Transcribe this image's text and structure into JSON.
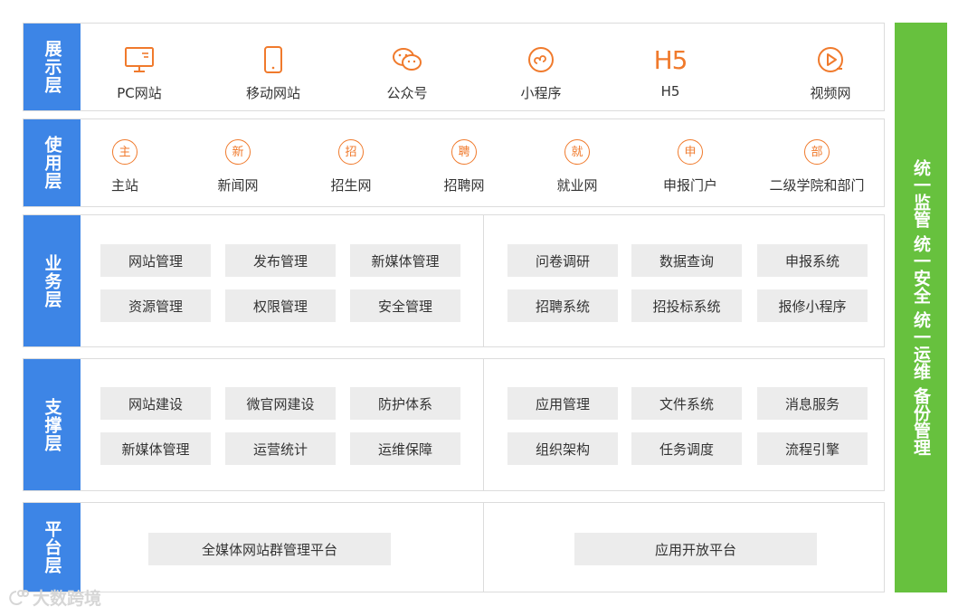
{
  "colors": {
    "label_bg": "#3d85e6",
    "accent": "#f07a2c",
    "right_bar": "#67c13e",
    "box_bg": "#ececec"
  },
  "layers": {
    "display": {
      "label": "展示层",
      "items": [
        {
          "label": "PC网站",
          "icon": "monitor-icon"
        },
        {
          "label": "移动网站",
          "icon": "mobile-phone-icon"
        },
        {
          "label": "公众号",
          "icon": "wechat-icon"
        },
        {
          "label": "小程序",
          "icon": "mini-program-icon"
        },
        {
          "label": "H5",
          "icon": "h5-icon",
          "icon_text": "H5"
        },
        {
          "label": "视频网",
          "icon": "video-play-icon"
        }
      ]
    },
    "usage": {
      "label": "使用层",
      "items": [
        {
          "label": "主站",
          "badge": "主"
        },
        {
          "label": "新闻网",
          "badge": "新"
        },
        {
          "label": "招生网",
          "badge": "招"
        },
        {
          "label": "招聘网",
          "badge": "聘"
        },
        {
          "label": "就业网",
          "badge": "就"
        },
        {
          "label": "申报门户",
          "badge": "申"
        },
        {
          "label": "二级学院和部门",
          "badge": "部"
        }
      ]
    },
    "business": {
      "label": "业务层",
      "left": [
        "网站管理",
        "发布管理",
        "新媒体管理",
        "资源管理",
        "权限管理",
        "安全管理"
      ],
      "right": [
        "问卷调研",
        "数据查询",
        "申报系统",
        "招聘系统",
        "招投标系统",
        "报修小程序"
      ]
    },
    "support": {
      "label": "支撑层",
      "left": [
        "网站建设",
        "微官网建设",
        "防护体系",
        "新媒体管理",
        "运营统计",
        "运维保障"
      ],
      "right": [
        "应用管理",
        "文件系统",
        "消息服务",
        "组织架构",
        "任务调度",
        "流程引擎"
      ]
    },
    "platform": {
      "label": "平台层",
      "left": "全媒体网站群管理平台",
      "right": "应用开放平台"
    }
  },
  "right_bar": [
    "统一监管",
    "统一安全",
    "统一运维",
    "备份管理"
  ],
  "watermark": "大数跨境"
}
